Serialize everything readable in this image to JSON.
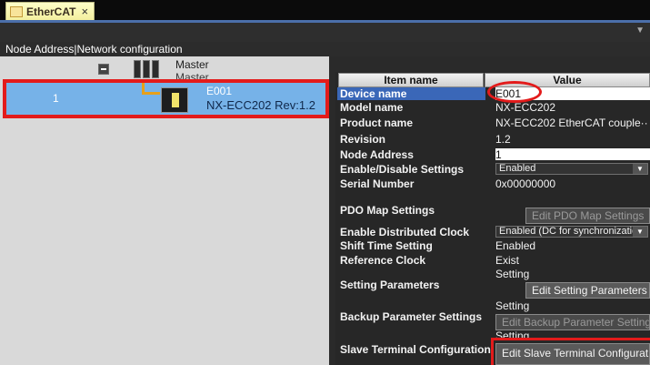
{
  "tab": {
    "label": "EtherCAT",
    "close": "×"
  },
  "tree": {
    "header": "Node Address|Network configuration",
    "master": {
      "name": "Master",
      "sub": "Master"
    },
    "node": {
      "address": "1",
      "name": "E001",
      "model": "NX-ECC202 Rev:1.2"
    }
  },
  "table": {
    "col_item": "Item name",
    "col_value": "Value",
    "rows": {
      "device_name": {
        "label": "Device name",
        "value": "E001"
      },
      "model_name": {
        "label": "Model name",
        "value": "NX-ECC202"
      },
      "product_name": {
        "label": "Product name",
        "value": "NX-ECC202 EtherCAT couple···"
      },
      "revision": {
        "label": "Revision",
        "value": "1.2"
      },
      "node_address": {
        "label": "Node Address",
        "value": "1"
      },
      "enable_disable": {
        "label": "Enable/Disable Settings",
        "value": "Enabled"
      },
      "serial_number": {
        "label": "Serial Number",
        "value": "0x00000000"
      },
      "pdo_map": {
        "label": "PDO Map Settings",
        "button": "Edit PDO Map Settings"
      },
      "distributed_clock": {
        "label": "Enable Distributed Clock",
        "value": "Enabled (DC for synchronizatio"
      },
      "shift_time": {
        "label": "Shift Time Setting",
        "value": "Enabled"
      },
      "reference_clock": {
        "label": "Reference Clock",
        "value": "Exist"
      },
      "setting_params": {
        "label": "Setting Parameters",
        "value": "Setting",
        "button": "Edit Setting Parameters"
      },
      "backup_params": {
        "label": "Backup Parameter Settings",
        "value": "Setting",
        "button": "Edit Backup Parameter Setting"
      },
      "slave_terminal": {
        "label": "Slave Terminal Configuration",
        "value": "Setting",
        "button": "Edit Slave Terminal Configurat"
      }
    }
  },
  "icons": {
    "tab_icon": "ethercat-tab-icon",
    "collapse": "collapse-minus-icon",
    "master": "master-controller-icon",
    "device": "coupler-device-icon",
    "dropdown": "dropdown-arrow-icon"
  },
  "colors": {
    "highlight_red": "#e31b1b",
    "selection_blue": "#76b2e8",
    "tab_yellow": "#f3ef9e",
    "connector_orange": "#e7a01a"
  }
}
